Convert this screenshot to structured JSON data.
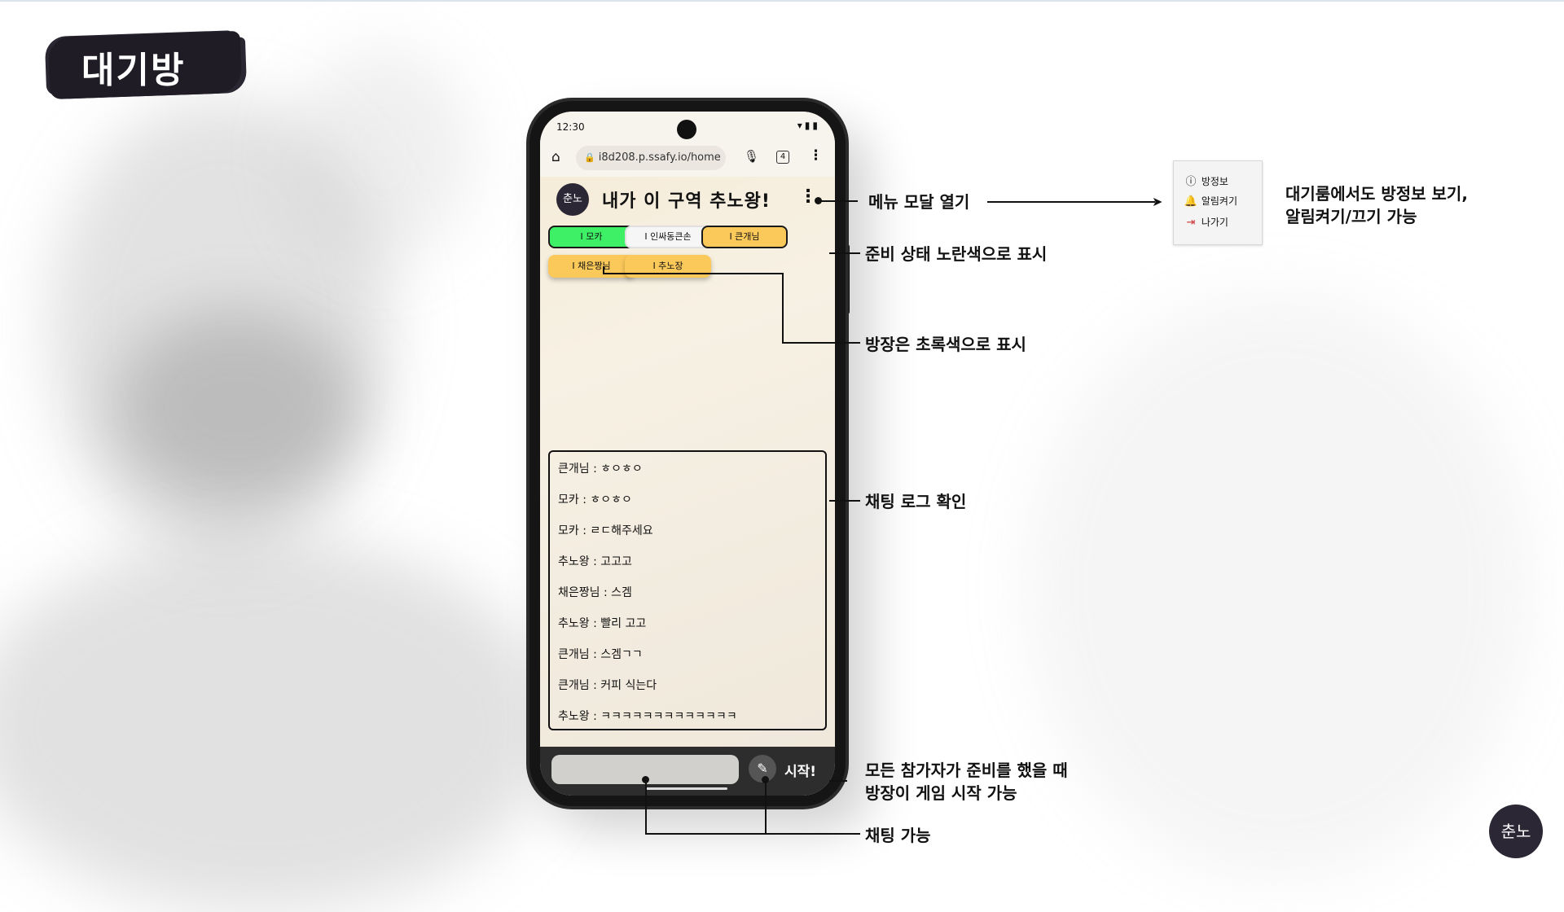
{
  "page": {
    "title": "대기방"
  },
  "phone": {
    "status": {
      "time": "12:30",
      "icons": "▾▮▮"
    },
    "browser": {
      "url": "i8d208.p.ssafy.io/home",
      "tab_count": "4"
    },
    "app": {
      "logo": "춘노",
      "title": "내가 이 구역 추노왕!",
      "menu_icon": "⋮",
      "players": [
        {
          "name": "I 모카",
          "color": "#3df065"
        },
        {
          "name": "I 인싸동큰손",
          "color": "#f6f6f6"
        },
        {
          "name": "I 큰개님",
          "color": "#fbc85a"
        },
        {
          "name": "I 채은짱님",
          "color": "#fbc85a"
        },
        {
          "name": "I 추노장",
          "color": "#fbc85a"
        }
      ],
      "chat": [
        "큰개님 : ㅎㅇㅎㅇ",
        "모카 : ㅎㅇㅎㅇ",
        "모카 : ㄹㄷ해주세요",
        "추노왕 : 고고고",
        "채은짱님 : 스겜",
        "추노왕 : 빨리 고고",
        "큰개님 : 스겜ㄱㄱ",
        "큰개님 : 커피 식는다",
        "추노왕 : ㅋㅋㅋㅋㅋㅋㅋㅋㅋㅋㅋㅋㅋ"
      ],
      "input_value": "",
      "start_label": "시작!"
    }
  },
  "annotations": {
    "menu": "메뉴 모달 열기",
    "ready": "준비 상태 노란색으로 표시",
    "host": "방장은 초록색으로 표시",
    "chat_log": "채팅 로그 확인",
    "start_line1": "모든 참가자가 준비를 했을 때",
    "start_line2": "방장이 게임 시작 가능",
    "chat": "채팅 가능",
    "menu_desc_line1": "대기룸에서도 방정보 보기,",
    "menu_desc_line2": "알림켜기/끄기 가능"
  },
  "menu_modal": {
    "items": [
      {
        "icon": "info-icon",
        "label": "방정보"
      },
      {
        "icon": "bell-icon",
        "label": "알림켜기"
      },
      {
        "icon": "exit-icon",
        "label": "나가기"
      }
    ]
  },
  "colors": {
    "host": "#3df065",
    "ready": "#fbc85a",
    "idle": "#f6f6f6",
    "ink": "#2c2734"
  }
}
